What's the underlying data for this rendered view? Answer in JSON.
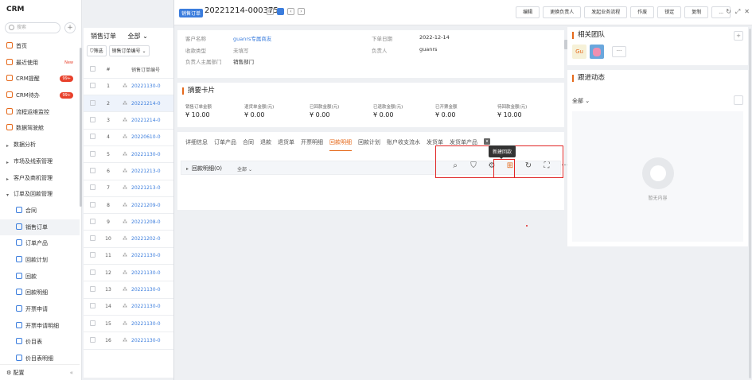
{
  "nav": {
    "brand": "CRM",
    "search_placeholder": "搜索",
    "items": [
      {
        "label": "首页",
        "type": "item"
      },
      {
        "label": "最近使用",
        "type": "item",
        "tag": "New"
      },
      {
        "label": "CRM提醒",
        "type": "item",
        "badge": "99+"
      },
      {
        "label": "CRM待办",
        "type": "item",
        "badge": "99+"
      },
      {
        "label": "流程运维监控",
        "type": "item"
      },
      {
        "label": "数据驾驶舱",
        "type": "item"
      },
      {
        "label": "数据分析",
        "type": "group"
      },
      {
        "label": "市场及线索管理",
        "type": "group"
      },
      {
        "label": "客户及商机管理",
        "type": "group"
      },
      {
        "label": "订单及回款管理",
        "type": "group-open"
      },
      {
        "label": "合同",
        "type": "sub"
      },
      {
        "label": "销售订单",
        "type": "sub",
        "active": true
      },
      {
        "label": "订单产品",
        "type": "sub"
      },
      {
        "label": "回款计划",
        "type": "sub"
      },
      {
        "label": "回款",
        "type": "sub"
      },
      {
        "label": "回款明细",
        "type": "sub"
      },
      {
        "label": "开票申请",
        "type": "sub"
      },
      {
        "label": "开票申请明细",
        "type": "sub"
      },
      {
        "label": "价目表",
        "type": "sub"
      },
      {
        "label": "价目表明细",
        "type": "sub"
      }
    ],
    "footer": "配置",
    "collapse": "«"
  },
  "list": {
    "title": "销售订单",
    "scope": "全部",
    "filter_label": "筛选",
    "field_label": "销售订单编号",
    "header_no": "#",
    "header_code": "销售订单编号",
    "rows": [
      {
        "no": "1",
        "code": "20221130-0"
      },
      {
        "no": "2",
        "code": "20221214-0",
        "selected": true
      },
      {
        "no": "3",
        "code": "20221214-0"
      },
      {
        "no": "4",
        "code": "20220610-0"
      },
      {
        "no": "5",
        "code": "20221130-0"
      },
      {
        "no": "6",
        "code": "20221213-0"
      },
      {
        "no": "7",
        "code": "20221213-0"
      },
      {
        "no": "8",
        "code": "20221209-0"
      },
      {
        "no": "9",
        "code": "20221208-0"
      },
      {
        "no": "10",
        "code": "20221202-0"
      },
      {
        "no": "11",
        "code": "20221130-0"
      },
      {
        "no": "12",
        "code": "20221130-0"
      },
      {
        "no": "13",
        "code": "20221130-0"
      },
      {
        "no": "14",
        "code": "20221130-0"
      },
      {
        "no": "15",
        "code": "20221130-0"
      },
      {
        "no": "16",
        "code": "20221130-0"
      }
    ]
  },
  "detail": {
    "tag": "销售订单",
    "record_no": "20221214-000375",
    "actions": [
      "编辑",
      "更换负责人",
      "发起业务流程",
      "作废",
      "锁定",
      "复制",
      "..."
    ],
    "info": {
      "customer_label": "客户名称",
      "customer_value": "guanrs专属商友",
      "date_label": "下单日期",
      "date_value": "2022-12-14",
      "type_label": "收款类型",
      "type_value": "未填写",
      "owner_label": "负责人",
      "owner_value": "guanrs",
      "dept_label": "负责人主属部门",
      "dept_value": "销售部门"
    },
    "summary": {
      "title": "摘要卡片",
      "cells": [
        {
          "k": "销售订单金额",
          "v": "¥ 10.00"
        },
        {
          "k": "退货单金额(元)",
          "v": "¥ 0.00"
        },
        {
          "k": "已回款金额(元)",
          "v": "¥ 0.00"
        },
        {
          "k": "已退款金额(元)",
          "v": "¥ 0.00"
        },
        {
          "k": "已开票金额",
          "v": "¥ 0.00"
        },
        {
          "k": "待回款金额(元)",
          "v": "¥ 10.00"
        }
      ]
    },
    "tabs": [
      "详细信息",
      "订单产品",
      "合同",
      "退款",
      "退货单",
      "开票明细",
      "回款明细",
      "回款计划",
      "账户收支流水",
      "发货单",
      "发货单产品"
    ],
    "active_tab": "回款明细",
    "section_title": "回款明细(0)",
    "section_filter": "全部",
    "tooltip": "新建回款"
  },
  "right": {
    "team_title": "相关团队",
    "avatar_text": "Gu",
    "avatar_more": "···",
    "follow_title": "跟进动态",
    "follow_filter": "全部",
    "empty_text": "暂无内容"
  }
}
